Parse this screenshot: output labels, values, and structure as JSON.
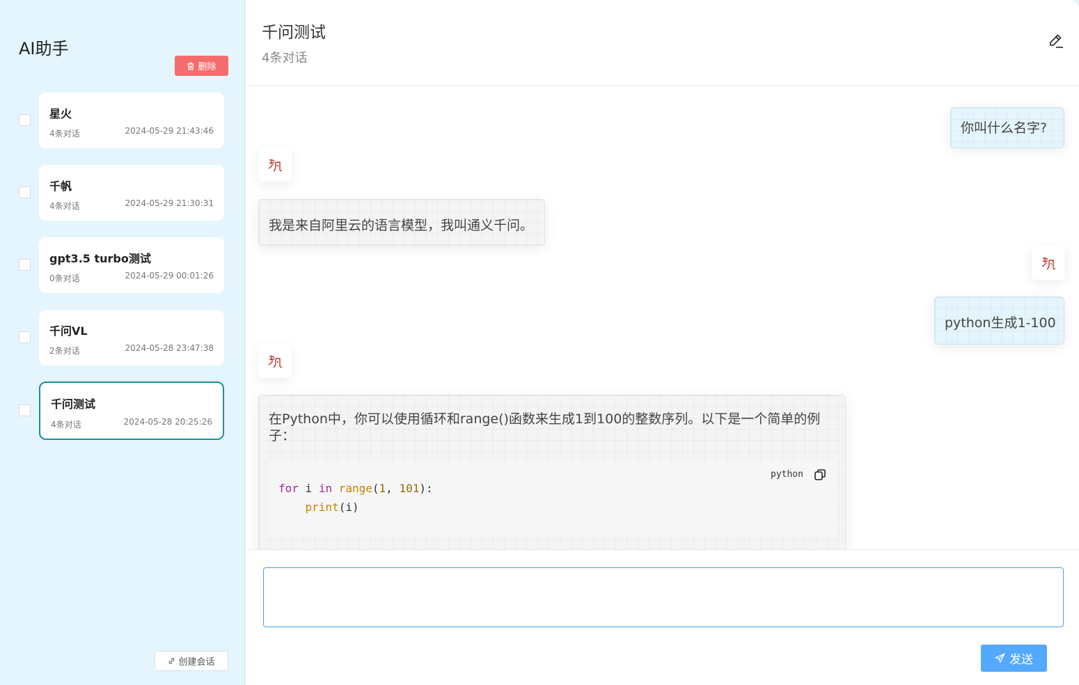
{
  "sidebar": {
    "title": "AI助手",
    "delete_label": "删除",
    "new_conversation_label": "创建会话",
    "conversations": [
      {
        "name": "星火",
        "count": "4条对话",
        "time": "2024-05-29 21:43:46"
      },
      {
        "name": "千帆",
        "count": "4条对话",
        "time": "2024-05-29 21:30:31"
      },
      {
        "name": "gpt3.5 turbo测试",
        "count": "0条对话",
        "time": "2024-05-29 00:01:26"
      },
      {
        "name": "千问VL",
        "count": "2条对话",
        "time": "2024-05-28 23:47:38"
      },
      {
        "name": "千问测试",
        "count": "4条对话",
        "time": "2024-05-28 20:25:26",
        "active": true
      }
    ]
  },
  "chat": {
    "title": "千问测试",
    "subtitle": "4条对话",
    "messages": [
      {
        "role": "user",
        "text": "你叫什么名字?"
      },
      {
        "role": "assistant",
        "text": "我是来自阿里云的语言模型，我叫通义千问。"
      },
      {
        "role": "user",
        "text": "python生成1-100"
      },
      {
        "role": "assistant",
        "text": "在Python中，你可以使用循环和range()函数来生成1到100的整数序列。以下是一个简单的例子：",
        "code": {
          "language": "python",
          "lines": [
            "for i in range(1, 101):",
            "    print(i)"
          ]
        }
      }
    ]
  },
  "input": {
    "value": "",
    "send_label": "发送"
  },
  "colors": {
    "sidebar_bg": "#e5f5fd",
    "delete": "#f56c6c",
    "send": "#53a8ff",
    "active_border": "#1a8f9a"
  }
}
